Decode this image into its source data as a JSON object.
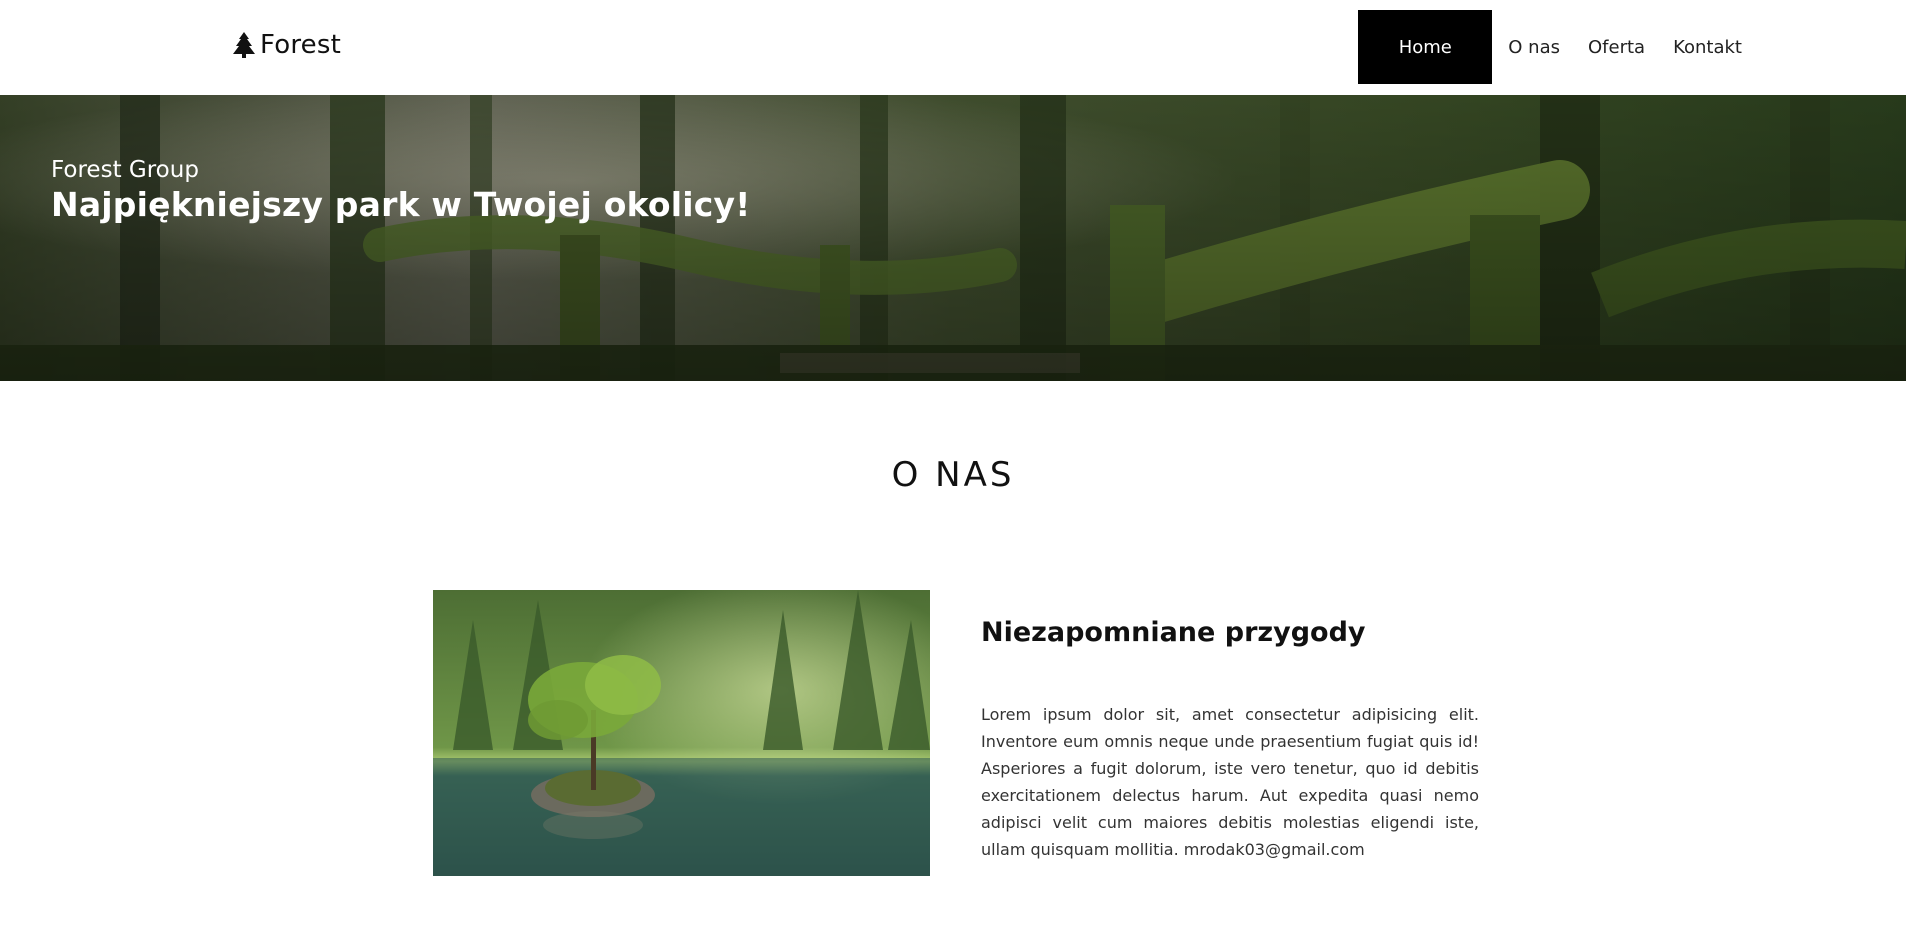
{
  "brand": {
    "name": "Forest",
    "icon": "tree-icon"
  },
  "nav": {
    "items": [
      {
        "label": "Home",
        "active": true
      },
      {
        "label": "O nas",
        "active": false
      },
      {
        "label": "Oferta",
        "active": false
      },
      {
        "label": "Kontakt",
        "active": false
      }
    ]
  },
  "hero": {
    "subtitle": "Forest Group",
    "title": "Najpiękniejszy park w Twojej okolicy!"
  },
  "about": {
    "section_title": "O NAS",
    "heading": "Niezapomniane przygody",
    "body": "Lorem ipsum dolor sit, amet consectetur adipisicing elit. Inventore eum omnis neque unde praesentium fugiat quis id! Asperiores a fugit dolorum, iste vero tenetur, quo id debitis exercitationem delectus harum. Aut expedita quasi nemo adipisci velit cum maiores debitis molestias eligendi iste, ullam quisquam mollitia. mrodak03@gmail.com"
  },
  "colors": {
    "nav_active_bg": "#000000",
    "nav_active_text": "#ffffff",
    "hero_text": "#ffffff"
  }
}
